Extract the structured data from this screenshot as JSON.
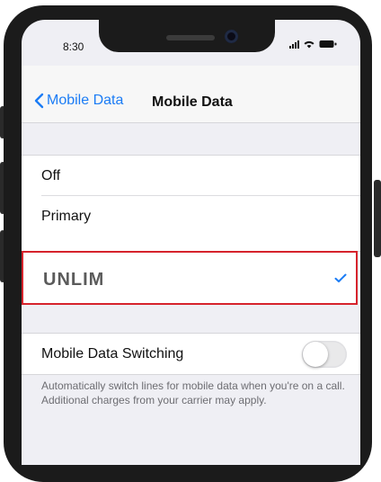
{
  "status_bar": {
    "time": "8:30"
  },
  "nav": {
    "back_label": "Mobile Data",
    "title": "Mobile Data"
  },
  "lines": {
    "items": [
      {
        "label": "Off",
        "selected": false
      },
      {
        "label": "Primary",
        "selected": false
      },
      {
        "label": "UNLIM",
        "selected": true
      }
    ]
  },
  "switching": {
    "label": "Mobile Data Switching",
    "enabled": false,
    "footnote": "Automatically switch lines for mobile data when you're on a call. Additional charges from your carrier may apply."
  },
  "colors": {
    "accent": "#1b7cf5",
    "highlight_border": "#d6232c"
  }
}
